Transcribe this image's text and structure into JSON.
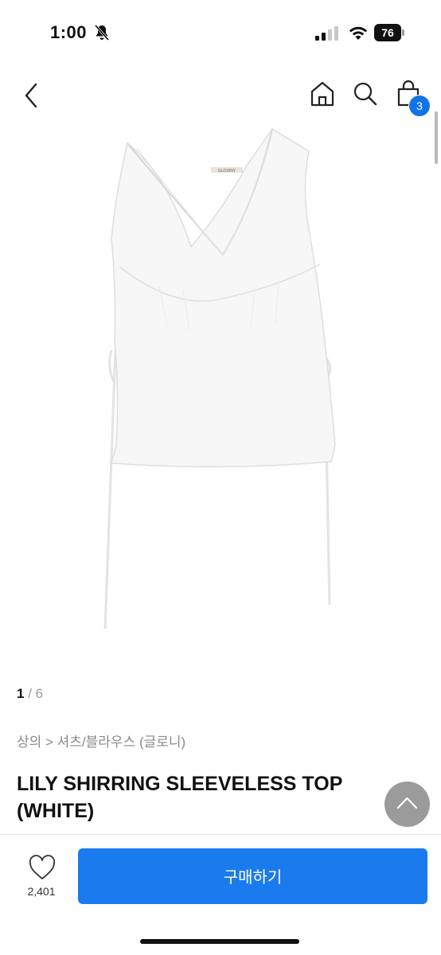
{
  "status_bar": {
    "time": "1:00",
    "battery": "76",
    "icons": [
      "bell-slash-icon",
      "signal-icon",
      "wifi-icon",
      "battery-icon"
    ]
  },
  "nav": {
    "icons": [
      "back-icon",
      "home-icon",
      "search-icon",
      "cart-icon"
    ],
    "cart_count": "3",
    "badge_color": "#1273e6"
  },
  "gallery": {
    "current": "1",
    "separator": " / ",
    "total": "6"
  },
  "product": {
    "breadcrumb": "상의 > 셔츠/블라우스 (글로니)",
    "title": "LILY SHIRRING SLEEVELESS TOP (WHITE)",
    "image_icon": "product-photo",
    "image_label": "GLOWNY"
  },
  "bottom_bar": {
    "like_count": "2,401",
    "buy_label": "구매하기",
    "buy_color": "#1a7bef"
  }
}
